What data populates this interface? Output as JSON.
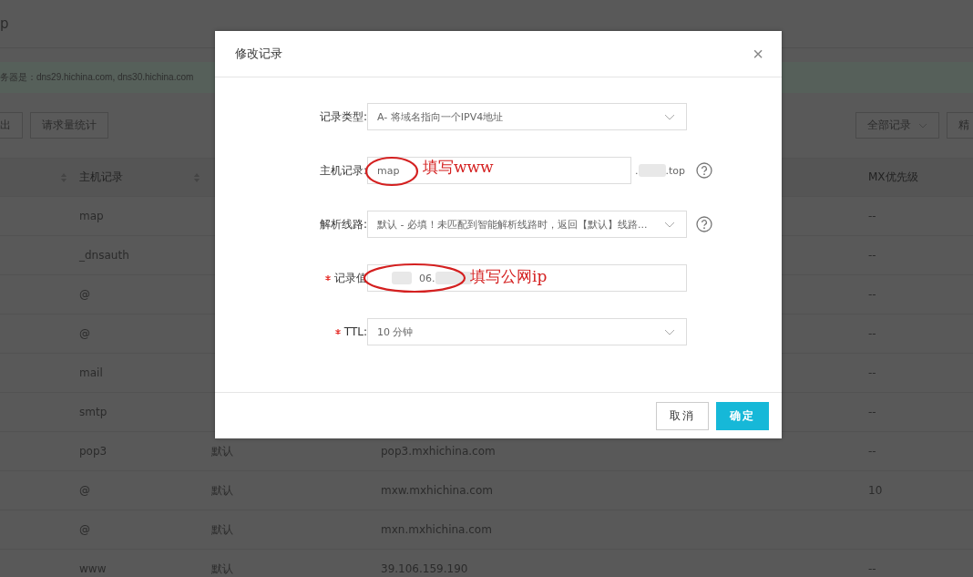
{
  "page": {
    "title": "p",
    "notice": "务器是：dns29.hichina.com, dns30.hichina.com",
    "toolbar_buttons": [
      "出",
      "请求量统计"
    ],
    "filter": "全部记录",
    "search_button": "精"
  },
  "table": {
    "columns": [
      "主机记录",
      "MX优先级"
    ],
    "rows": [
      {
        "host": "map",
        "mx": "--"
      },
      {
        "host": "_dnsauth",
        "mx": "--"
      },
      {
        "host": "@",
        "mx": "--"
      },
      {
        "host": "@",
        "mx": "--"
      },
      {
        "host": "mail",
        "mx": "--"
      },
      {
        "host": "smtp",
        "mx": "--"
      },
      {
        "host": "pop3",
        "line": "默认",
        "value": "pop3.mxhichina.com",
        "mx": "--"
      },
      {
        "host": "@",
        "line": "默认",
        "value": "mxw.mxhichina.com",
        "mx": "10"
      },
      {
        "host": "@",
        "line": "默认",
        "value": "mxn.mxhichina.com"
      },
      {
        "host": "www",
        "line": "默认",
        "value": "39.106.159.190",
        "mx": "--"
      }
    ]
  },
  "dialog": {
    "title": "修改记录",
    "close": "×",
    "fields": [
      {
        "kind": "select",
        "label": "记录类型:",
        "value": "A- 将域名指向一个IPV4地址",
        "required": false,
        "help": false
      },
      {
        "kind": "input",
        "label": "主机记录:",
        "value": "map",
        "suffix_start": ".",
        "suffix_end": ".top",
        "required": false,
        "help": true,
        "annotation": "填写www"
      },
      {
        "kind": "select",
        "label": "解析线路:",
        "value": "默认 - 必填！未匹配到智能解析线路时，返回【默认】线路...",
        "required": false,
        "help": true
      },
      {
        "kind": "input",
        "label": "记录值",
        "value": "06.",
        "required": true,
        "help": false,
        "annotation": "填写公网ip",
        "redacted": true
      },
      {
        "kind": "select",
        "label": "TTL:",
        "value": "10 分钟",
        "required": true,
        "help": false
      }
    ],
    "buttons": [
      {
        "label": "取消",
        "kind": "secondary"
      },
      {
        "label": "确定",
        "kind": "primary"
      }
    ]
  }
}
